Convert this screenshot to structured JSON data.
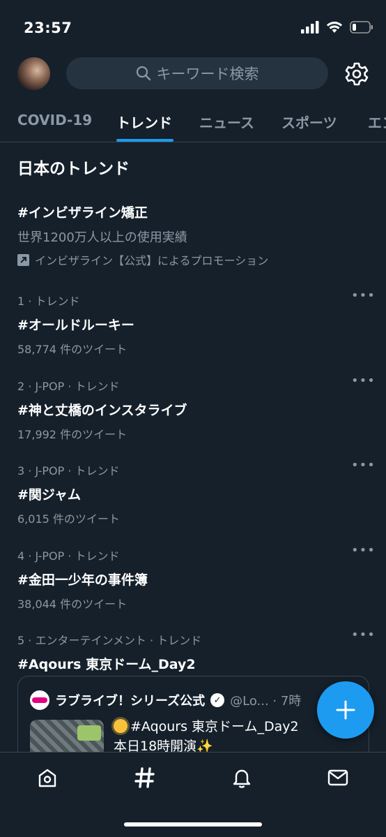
{
  "status_bar": {
    "time": "23:57"
  },
  "search": {
    "placeholder": "キーワード検索"
  },
  "tabs": [
    {
      "label": "COVID-19"
    },
    {
      "label": "トレンド"
    },
    {
      "label": "ニュース"
    },
    {
      "label": "スポーツ"
    },
    {
      "label": "エン"
    }
  ],
  "section": {
    "title": "日本のトレンド"
  },
  "promoted": {
    "name": "#インビザライン矯正",
    "description": "世界1200万人以上の使用実績",
    "promoted_by": "インビザライン【公式】によるプロモーション"
  },
  "trends": [
    {
      "meta": "1 · トレンド",
      "name": "#オールドルーキー",
      "count": "58,774 件のツイート"
    },
    {
      "meta": "2 · J-POP · トレンド",
      "name": "#神と丈橋のインスタライブ",
      "count": "17,992 件のツイート"
    },
    {
      "meta": "3 · J-POP · トレンド",
      "name": "#関ジャム",
      "count": "6,015 件のツイート"
    },
    {
      "meta": "4 · J-POP · トレンド",
      "name": "#金田一少年の事件簿",
      "count": "38,044 件のツイート"
    },
    {
      "meta": "5 · エンターテインメント · トレンド",
      "name": "#Aqours 東京ドーム_Day2",
      "count": ""
    }
  ],
  "tweet": {
    "author": "ラブライブ！シリーズ公式",
    "handle": "@Lo... · 7時",
    "line1": "#Aqours 東京ドーム_Day2",
    "line2": "本日18時開演",
    "sparkle": "✨"
  },
  "colors": {
    "background": "#15202b",
    "accent": "#1d9bf0",
    "secondary_text": "#8b98a5",
    "divider": "#38444d"
  }
}
